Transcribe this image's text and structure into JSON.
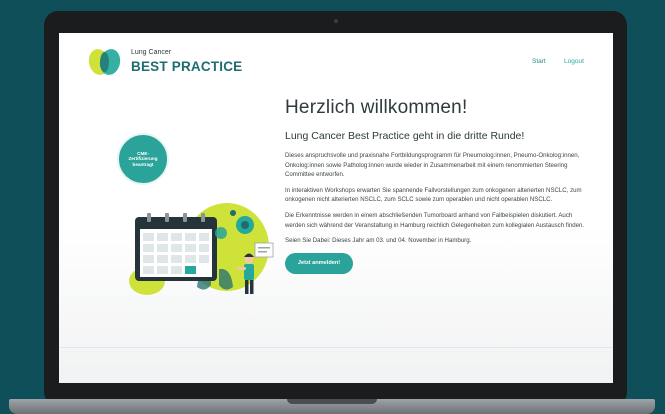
{
  "brand": {
    "top": "Lung Cancer",
    "name": "BEST PRACTICE"
  },
  "nav": {
    "start": "Start",
    "logout": "Logout"
  },
  "badge": {
    "line1": "CME-",
    "line2": "Zertifizierung",
    "line3": "beantragt"
  },
  "main": {
    "heading": "Herzlich willkommen!",
    "subheading": "Lung Cancer Best Practice geht in die dritte Runde!",
    "paragraphs": [
      "Dieses anspruchsvolle und praxisnahe Fortbildungsprogramm für Pneumolog:innen, Pneumo-Onkolog:innen, Onkolog:innen sowie Patholog:innen wurde wieder in Zusammenarbeit mit einem renommierten Steering Committee entworfen.",
      "In interaktiven Workshops erwarten Sie spannende Fallvorstellungen zum onkogenen alterierten NSCLC, zum onkogenen nicht alterierten NSCLC, zum SCLC sowie zum operablen und nicht operablen NSCLC.",
      "Die Erkenntnisse werden in einem abschließenden Tumorboard anhand von Fallbeispielen diskutiert. Auch werden sich während der Veranstaltung in Hamburg reichlich Gelegenheiten zum kollegialen Austausch finden.",
      "Seien Sie Dabei: Dieses Jahr am 03. und 04. November in Hamburg."
    ],
    "cta": "Jetzt anmelden!"
  },
  "colors": {
    "accent": "#2aa39a",
    "brand": "#1f6d72",
    "background": "#0f4f59",
    "lime": "#cfe23a"
  }
}
